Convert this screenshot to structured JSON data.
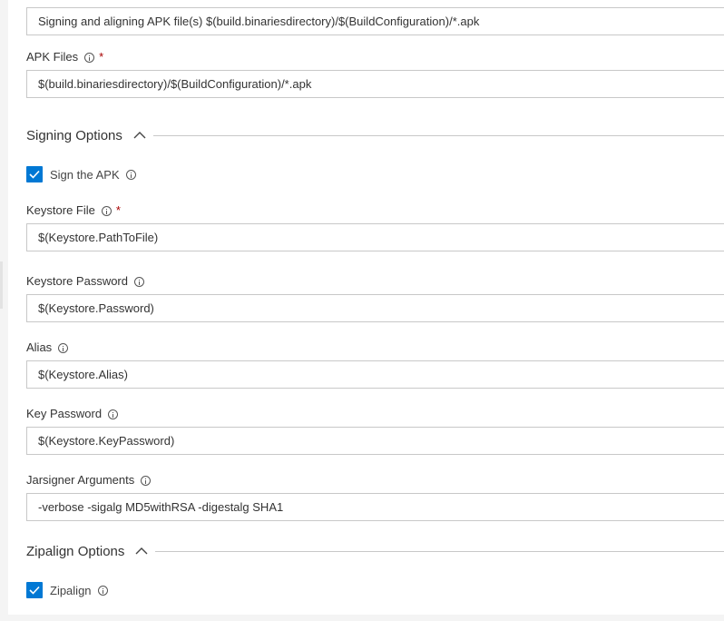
{
  "display_name": {
    "value": "Signing and aligning APK file(s) $(build.binariesdirectory)/$(BuildConfiguration)/*.apk"
  },
  "apk_files": {
    "label": "APK Files",
    "required_marker": "*",
    "value": "$(build.binariesdirectory)/$(BuildConfiguration)/*.apk"
  },
  "signing_options": {
    "title": "Signing Options",
    "sign_apk": {
      "label": "Sign the APK",
      "checked": true
    },
    "keystore_file": {
      "label": "Keystore File",
      "required_marker": "*",
      "value": "$(Keystore.PathToFile)"
    },
    "keystore_password": {
      "label": "Keystore Password",
      "value": "$(Keystore.Password)"
    },
    "alias": {
      "label": "Alias",
      "value": "$(Keystore.Alias)"
    },
    "key_password": {
      "label": "Key Password",
      "value": "$(Keystore.KeyPassword)"
    },
    "jarsigner_arguments": {
      "label": "Jarsigner Arguments",
      "value": "-verbose -sigalg MD5withRSA -digestalg SHA1"
    }
  },
  "zipalign_options": {
    "title": "Zipalign Options",
    "zipalign": {
      "label": "Zipalign",
      "checked": true
    }
  },
  "colors": {
    "accent": "#0078d4",
    "required": "#a80000",
    "border": "#c8c8c8"
  },
  "icons": {
    "info": "info-icon",
    "collapse": "chevron-up-icon",
    "check": "checkmark-icon"
  }
}
